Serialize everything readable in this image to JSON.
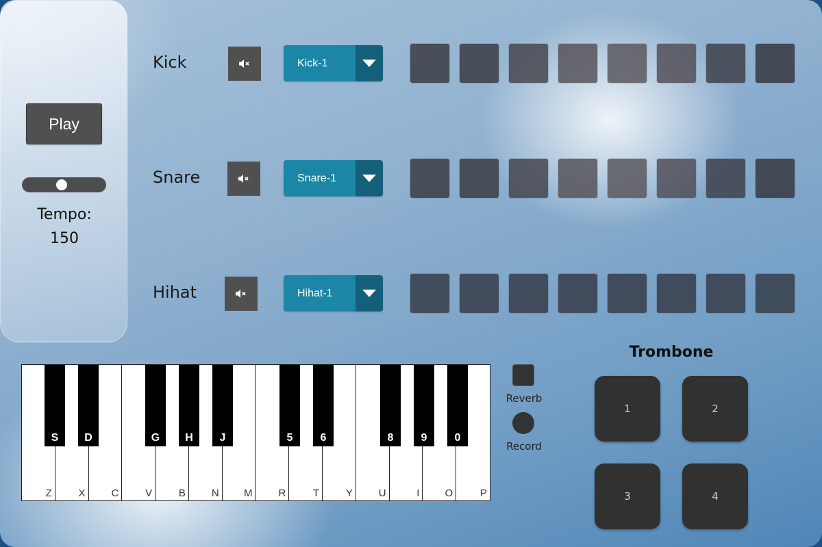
{
  "controls": {
    "play_label": "Play",
    "tempo_label": "Tempo:",
    "tempo_value": "150",
    "tempo_slider_fraction": 0.47
  },
  "tracks": [
    {
      "name": "Kick",
      "sample": "Kick-1",
      "steps": 8
    },
    {
      "name": "Snare",
      "sample": "Snare-1",
      "steps": 8
    },
    {
      "name": "Hihat",
      "sample": "Hihat-1",
      "steps": 8
    }
  ],
  "icons": {
    "mute": "speaker-muted-icon",
    "dropdown": "triangle-down-icon"
  },
  "piano": {
    "white_keys": [
      "Z",
      "X",
      "C",
      "V",
      "B",
      "N",
      "M",
      "R",
      "T",
      "Y",
      "U",
      "I",
      "O",
      "P"
    ],
    "black_keys": [
      "S",
      "D",
      "G",
      "H",
      "J",
      "5",
      "6",
      "8",
      "9",
      "0"
    ]
  },
  "effects": {
    "reverb_label": "Reverb",
    "record_label": "Record"
  },
  "trombone": {
    "title": "Trombone",
    "pads": [
      "1",
      "2",
      "3",
      "4"
    ]
  },
  "colors": {
    "select_bg": "#1b86a6",
    "select_arrow_bg": "#14607a",
    "button_bg": "#505050",
    "pad_bg": "#3e4048",
    "trombone_pad_bg": "#313131"
  }
}
